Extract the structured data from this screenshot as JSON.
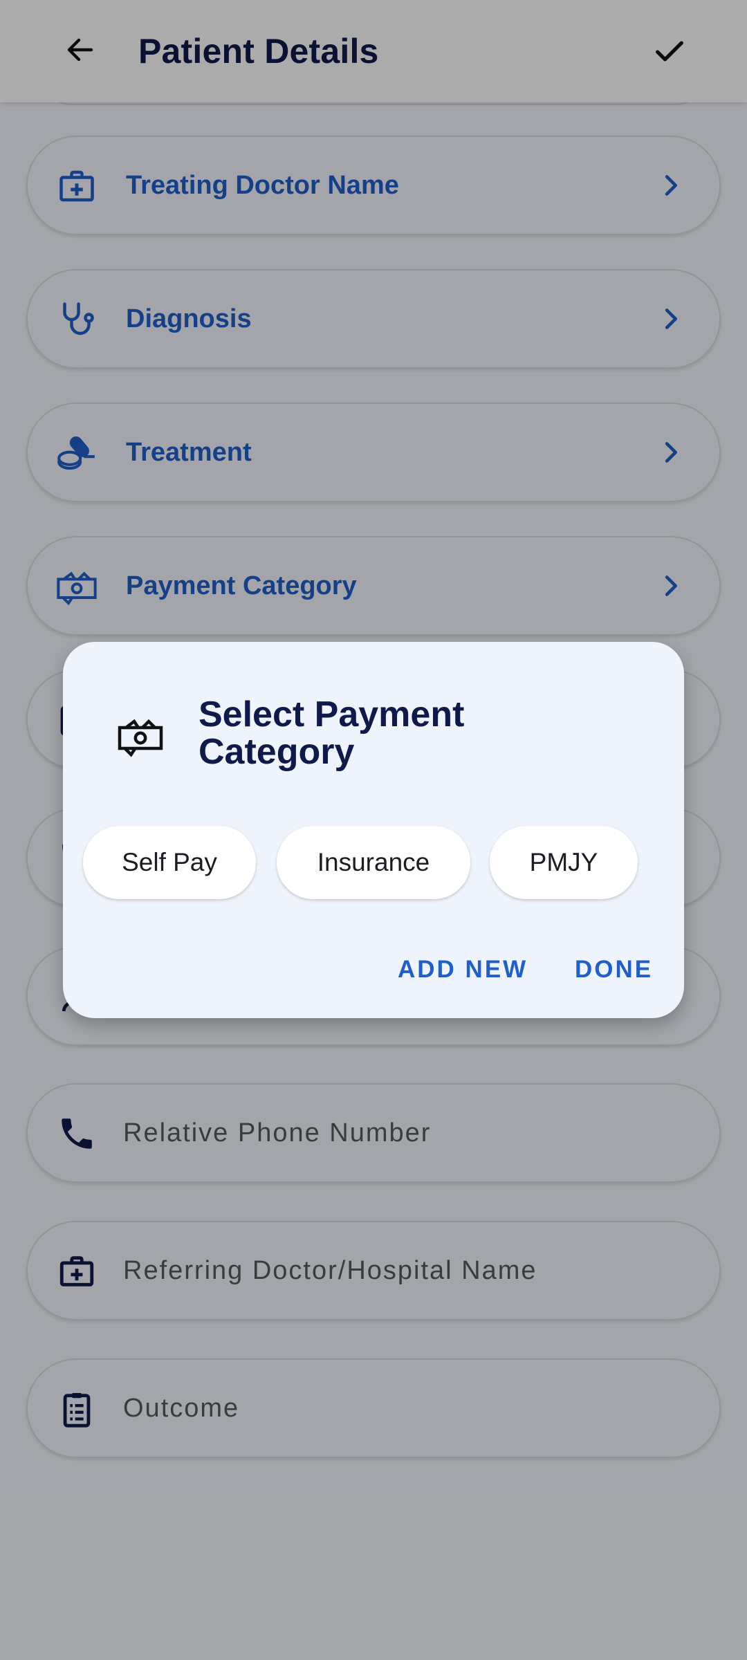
{
  "header": {
    "title": "Patient Details",
    "back_icon": "arrow-left-icon",
    "confirm_icon": "check-icon"
  },
  "form": {
    "rows": [
      {
        "label": "Treating Doctor Name",
        "icon": "medical-bag-icon"
      },
      {
        "label": "Diagnosis",
        "icon": "stethoscope-icon"
      },
      {
        "label": "Treatment",
        "icon": "pills-icon"
      },
      {
        "label": "Payment Category",
        "icon": "cash-icon"
      }
    ],
    "fields": [
      {
        "placeholder": "Relative Phone Number",
        "icon": "phone-icon"
      },
      {
        "placeholder": "Referring Doctor/Hospital Name",
        "icon": "medical-bag-icon"
      },
      {
        "placeholder": "Outcome",
        "icon": "clipboard-icon"
      }
    ]
  },
  "dialog": {
    "title": "Select Payment Category",
    "icon": "cash-icon",
    "options": [
      "Self Pay",
      "Insurance",
      "PMJY"
    ],
    "add_new_label": "ADD NEW",
    "done_label": "DONE"
  },
  "colors": {
    "accent": "#1f5fc9",
    "title": "#0f1a4a",
    "scrim": "rgba(0,0,0,0.32)",
    "dialog_bg": "#eff3fb"
  }
}
